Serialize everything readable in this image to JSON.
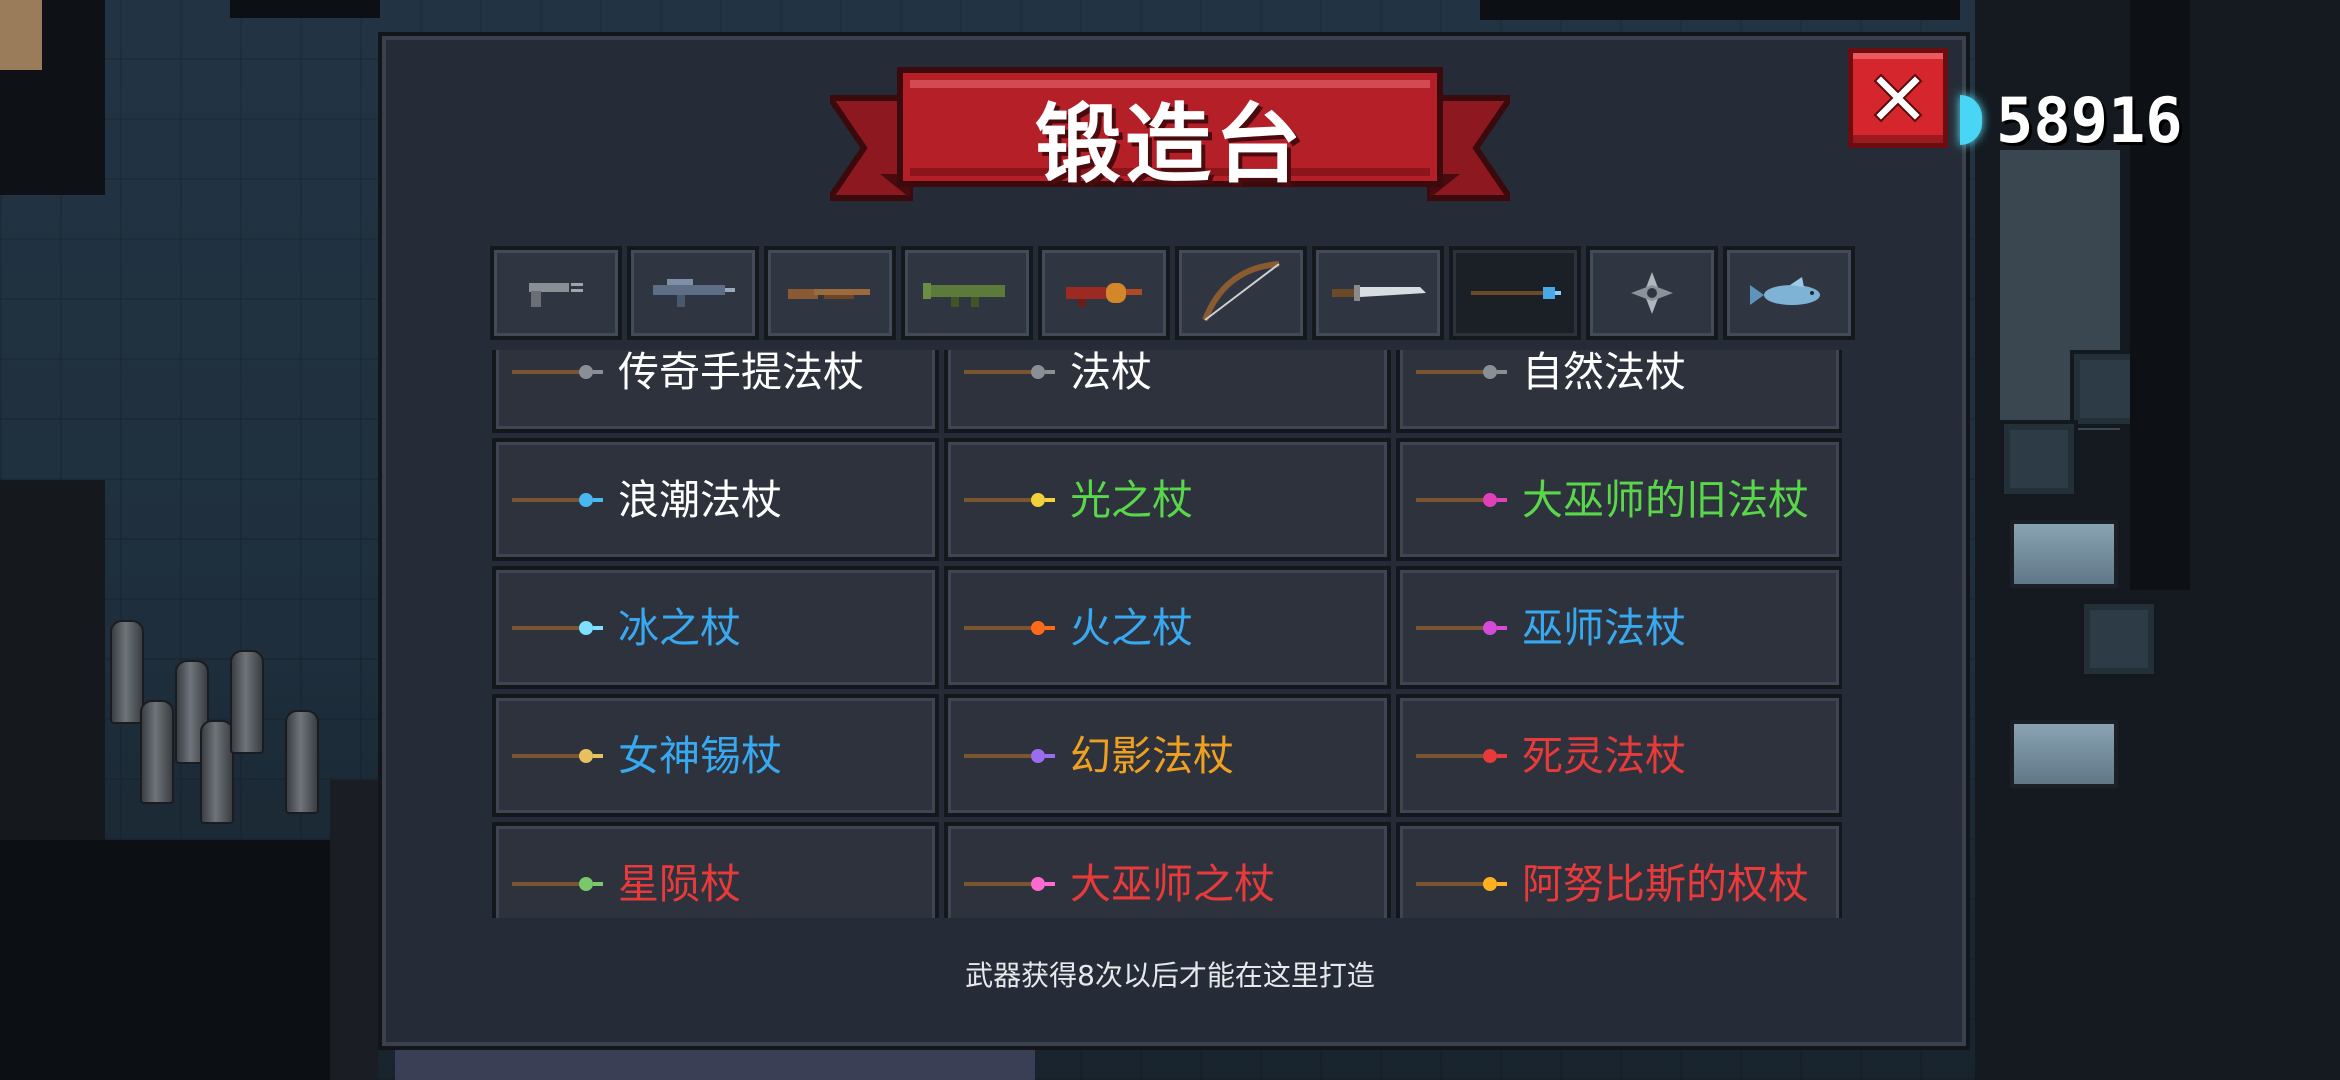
{
  "header": {
    "title": "锻造台"
  },
  "currency": {
    "value": "58916",
    "icon": "energy-gem-icon",
    "color": "#49d6f5"
  },
  "close": {
    "icon": "close-icon"
  },
  "tabs": [
    {
      "icon": "pistol-icon",
      "active": false
    },
    {
      "icon": "rifle-icon",
      "active": false
    },
    {
      "icon": "shotgun-icon",
      "active": false
    },
    {
      "icon": "launcher-icon",
      "active": false
    },
    {
      "icon": "flamethrower-icon",
      "active": false
    },
    {
      "icon": "bow-icon",
      "active": false
    },
    {
      "icon": "sword-icon",
      "active": false
    },
    {
      "icon": "staff-icon",
      "active": true
    },
    {
      "icon": "shuriken-icon",
      "active": false
    },
    {
      "icon": "fish-icon",
      "active": false
    }
  ],
  "items": [
    {
      "name": "传奇手提法杖",
      "color": "#ffffff",
      "icon": "staff-icon"
    },
    {
      "name": "法杖",
      "color": "#ffffff",
      "icon": "staff-icon"
    },
    {
      "name": "自然法杖",
      "color": "#ffffff",
      "icon": "staff-icon"
    },
    {
      "name": "浪潮法杖",
      "color": "#ffffff",
      "icon": "staff-icon",
      "gem": "#4ab8f0"
    },
    {
      "name": "光之杖",
      "color": "#5ad64b",
      "icon": "staff-icon",
      "gem": "#f2d13a"
    },
    {
      "name": "大巫师的旧法杖",
      "color": "#5ad64b",
      "icon": "staff-icon",
      "gem": "#e040b8"
    },
    {
      "name": "冰之杖",
      "color": "#38a8f0",
      "icon": "staff-icon",
      "gem": "#7ee0ff"
    },
    {
      "name": "火之杖",
      "color": "#38a8f0",
      "icon": "staff-icon",
      "gem": "#ff6a1a"
    },
    {
      "name": "巫师法杖",
      "color": "#38a8f0",
      "icon": "staff-icon",
      "gem": "#d64ad8"
    },
    {
      "name": "女神锡杖",
      "color": "#38a8f0",
      "icon": "staff-icon",
      "gem": "#e8c060"
    },
    {
      "name": "幻影法杖",
      "color": "#f0a020",
      "icon": "staff-icon",
      "gem": "#9a6cf0"
    },
    {
      "name": "死灵法杖",
      "color": "#e83a3a",
      "icon": "staff-icon",
      "gem": "#e83a3a"
    },
    {
      "name": "星陨杖",
      "color": "#e83a3a",
      "icon": "staff-icon",
      "gem": "#7bc86a"
    },
    {
      "name": "大巫师之杖",
      "color": "#e83a3a",
      "icon": "staff-icon",
      "gem": "#ff6ad0"
    },
    {
      "name": "阿努比斯的权杖",
      "color": "#e83a3a",
      "icon": "staff-icon",
      "gem": "#ffb020"
    }
  ],
  "footer": {
    "note": "武器获得8次以后才能在这里打造"
  }
}
